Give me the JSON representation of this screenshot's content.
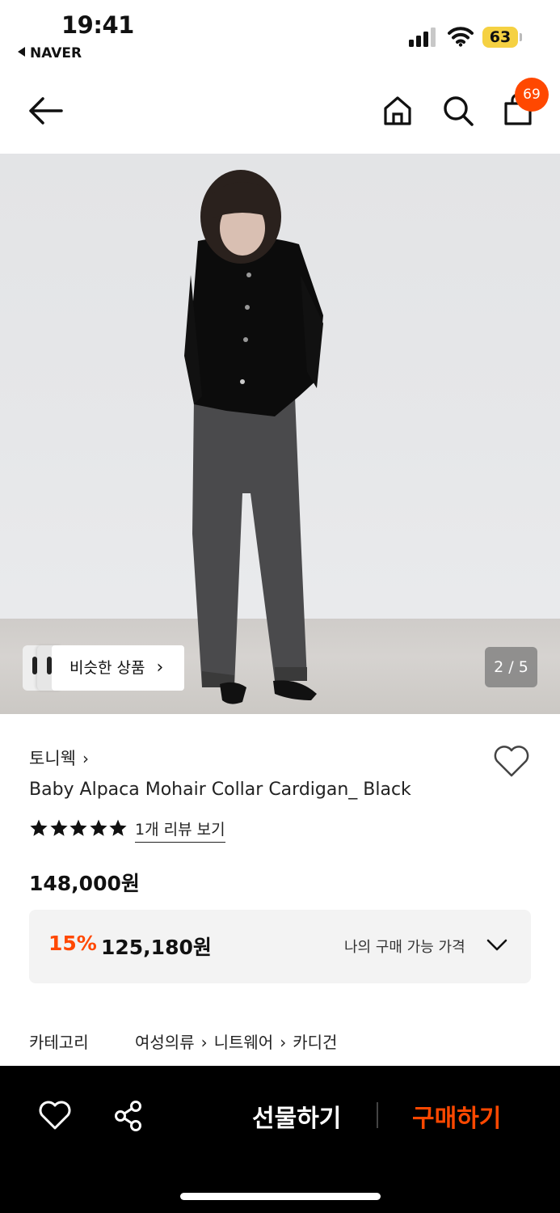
{
  "status_bar": {
    "time": "19:41",
    "back_app": "NAVER",
    "battery": "63",
    "signal_icon": "cellular-signal-icon",
    "wifi_icon": "wifi-icon"
  },
  "top_nav": {
    "back_icon": "arrow-left-icon",
    "home_icon": "home-icon",
    "search_icon": "search-icon",
    "cart_icon": "shopping-bag-icon",
    "cart_count": "69"
  },
  "gallery": {
    "similar_label": "비슷한 상품",
    "similar_chevron": "›",
    "counter": "2 / 5"
  },
  "product": {
    "brand": "토니웩",
    "brand_chevron": "›",
    "title": "Baby Alpaca Mohair Collar Cardigan_ Black",
    "rating_stars": 5,
    "review_link": "1개 리뷰 보기",
    "original_price": "148,000원",
    "discount_rate": "15%",
    "sale_price": "125,180원",
    "my_price_label": "나의 구매 가능 가격"
  },
  "category": {
    "label": "카테고리",
    "path": [
      "여성의류",
      "니트웨어",
      "카디건"
    ],
    "separator": "›"
  },
  "bottom_bar": {
    "wish_icon": "heart-icon",
    "share_icon": "share-icon",
    "gift_label": "선물하기",
    "buy_label": "구매하기"
  },
  "colors": {
    "accent": "#ff4800",
    "bottom_bar_bg": "#000000",
    "price_box_bg": "#f3f3f3",
    "battery": "#f5d142"
  }
}
